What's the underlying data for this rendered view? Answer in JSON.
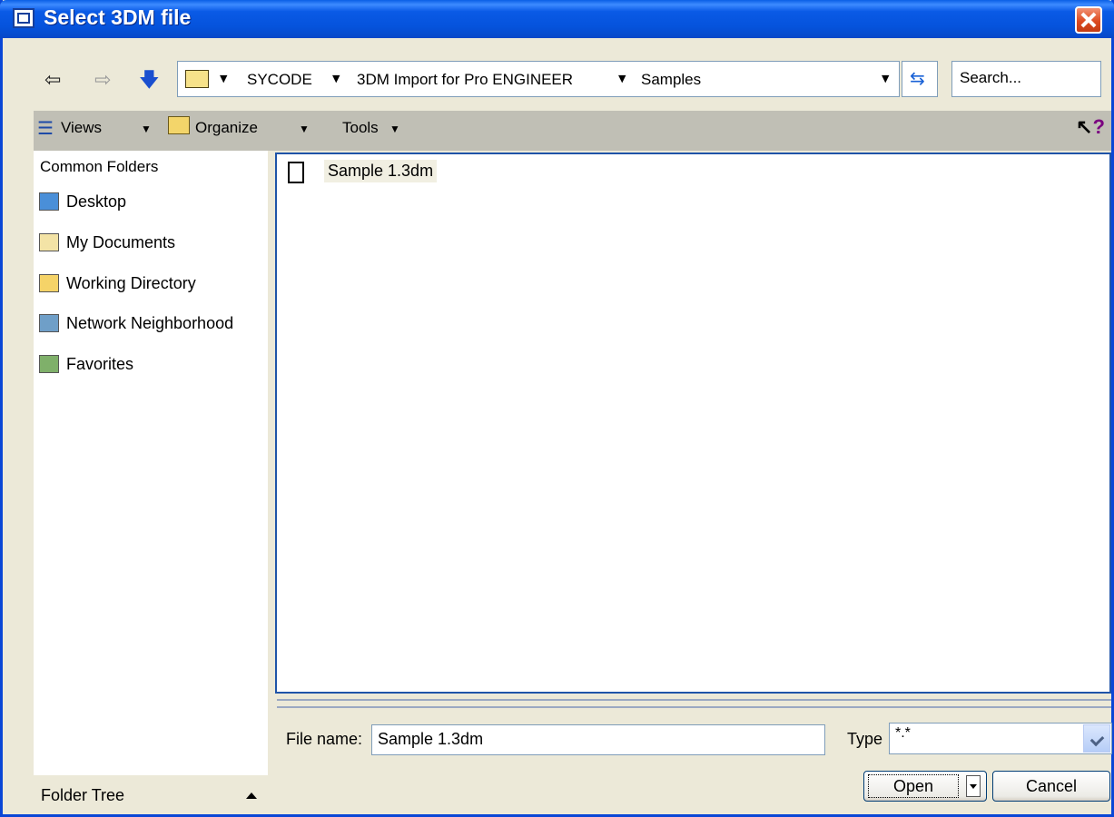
{
  "window": {
    "title": "Select 3DM file"
  },
  "nav": {
    "breadcrumbs": [
      "SYCODE",
      "3DM Import for Pro ENGINEER",
      "Samples"
    ],
    "search_placeholder": "Search..."
  },
  "toolbar": {
    "views_label": "Views",
    "organize_label": "Organize",
    "tools_label": "Tools"
  },
  "sidebar": {
    "header": "Common Folders",
    "items": [
      {
        "label": "Desktop",
        "icon": "desktop-icon"
      },
      {
        "label": "My Documents",
        "icon": "my-documents-icon"
      },
      {
        "label": "Working Directory",
        "icon": "working-directory-icon"
      },
      {
        "label": "Network Neighborhood",
        "icon": "network-icon"
      },
      {
        "label": "Favorites",
        "icon": "favorites-icon"
      }
    ],
    "folder_tree_label": "Folder Tree"
  },
  "files": [
    {
      "name": "Sample 1.3dm",
      "icon": "file-icon"
    }
  ],
  "footer": {
    "file_name_label": "File name:",
    "file_name_value": "Sample 1.3dm",
    "type_label": "Type",
    "type_value": "*.*",
    "open_label": "Open",
    "cancel_label": "Cancel"
  }
}
